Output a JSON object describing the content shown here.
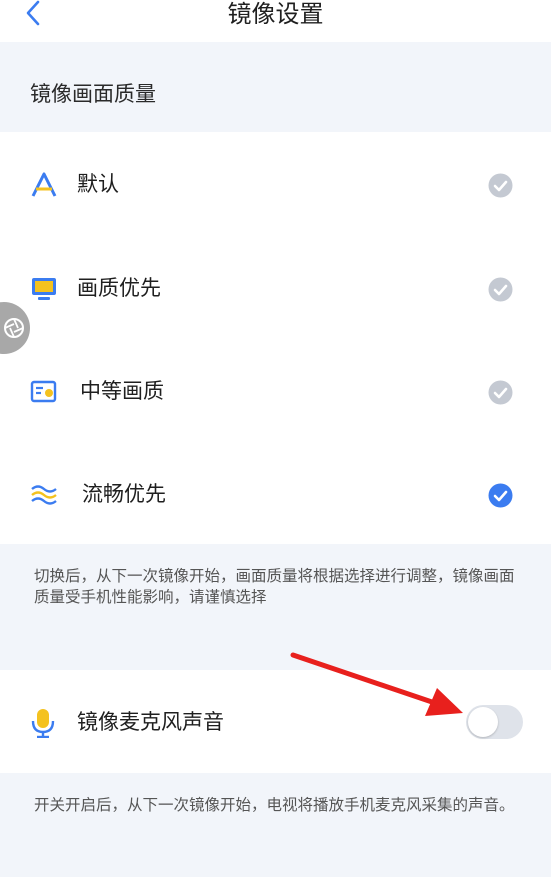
{
  "header": {
    "title": "镜像设置",
    "back_icon": "chevron-left-icon"
  },
  "section": {
    "title": "镜像画面质量"
  },
  "quality_options": [
    {
      "label": "默认",
      "icon": "letter-a-icon",
      "selected": false
    },
    {
      "label": "画质优先",
      "icon": "monitor-icon",
      "selected": false
    },
    {
      "label": "中等画质",
      "icon": "id-card-icon",
      "selected": false
    },
    {
      "label": "流畅优先",
      "icon": "waves-icon",
      "selected": true
    }
  ],
  "quality_hint": "切换后，从下一次镜像开始，画面质量将根据选择进行调整，镜像画面质量受手机性能影响，请谨慎选择",
  "mic": {
    "label": "镜像麦克风声音",
    "icon": "microphone-icon",
    "enabled": false
  },
  "mic_hint": "开关开启后，从下一次镜像开始，电视将播放手机麦克风采集的声音。",
  "colors": {
    "accent": "#3b7cf0",
    "check_inactive": "#c4c9d2",
    "icon_yellow": "#f4c21f",
    "background": "#f2f5fa",
    "annotation_arrow": "#e8201d"
  }
}
